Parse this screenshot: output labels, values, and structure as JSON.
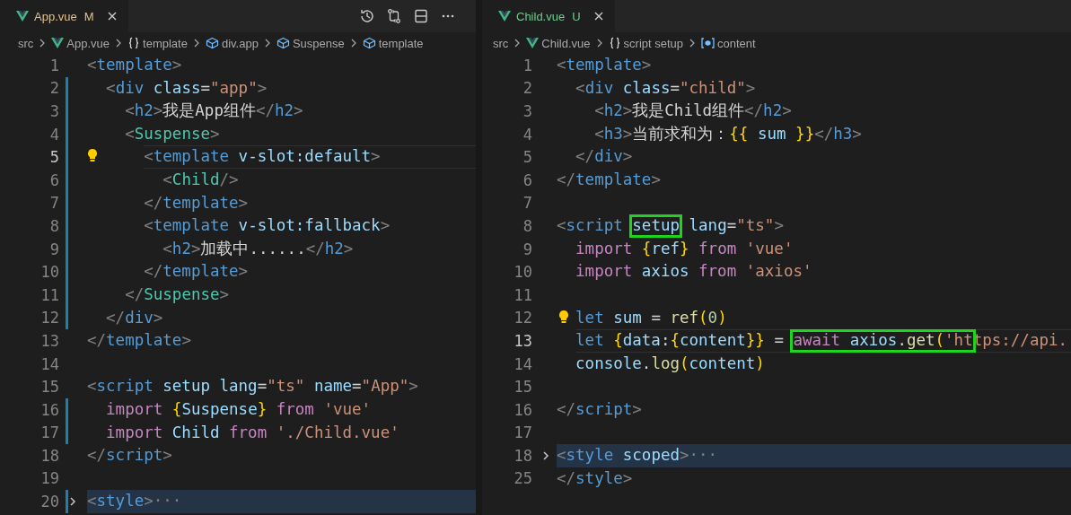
{
  "panes": [
    {
      "tab": {
        "label": "App.vue",
        "status": "M",
        "kind": "modified",
        "selected": true
      },
      "toolbar": true,
      "breadcrumbs": [
        {
          "label": "src",
          "kind": "folder"
        },
        {
          "label": "App.vue",
          "kind": "file"
        },
        {
          "label": "template",
          "kind": "block"
        },
        {
          "label": "div.app",
          "kind": "element"
        },
        {
          "label": "Suspense",
          "kind": "element"
        },
        {
          "label": "template",
          "kind": "element"
        }
      ],
      "lines": [
        {
          "number": "1",
          "tokens": [
            {
              "kind": "punct",
              "text": "<"
            },
            {
              "kind": "tag",
              "text": "template"
            },
            {
              "kind": "punct",
              "text": ">"
            }
          ]
        },
        {
          "number": "2",
          "modified": true,
          "tokens": [
            {
              "kind": "punct",
              "text": "  <"
            },
            {
              "kind": "tag",
              "text": "div"
            },
            {
              "kind": "attr",
              "text": " class"
            },
            {
              "kind": "text",
              "text": "="
            },
            {
              "kind": "string",
              "text": "\"app\""
            },
            {
              "kind": "punct",
              "text": ">"
            }
          ]
        },
        {
          "number": "3",
          "modified": true,
          "tokens": [
            {
              "kind": "punct",
              "text": "    <"
            },
            {
              "kind": "tag",
              "text": "h2"
            },
            {
              "kind": "punct",
              "text": ">"
            },
            {
              "kind": "text",
              "text": "我是App组件"
            },
            {
              "kind": "punct",
              "text": "</"
            },
            {
              "kind": "tag",
              "text": "h2"
            },
            {
              "kind": "punct",
              "text": ">"
            }
          ]
        },
        {
          "number": "4",
          "modified": true,
          "tokens": [
            {
              "kind": "punct",
              "text": "    <"
            },
            {
              "kind": "component",
              "text": "Suspense"
            },
            {
              "kind": "punct",
              "text": ">"
            }
          ]
        },
        {
          "number": "5",
          "modified": true,
          "current": true,
          "hint": true,
          "tokens": [
            {
              "kind": "punct",
              "text": "      <"
            },
            {
              "kind": "tag",
              "text": "template"
            },
            {
              "kind": "attr",
              "text": " v-slot:default"
            },
            {
              "kind": "punct",
              "text": ">"
            }
          ]
        },
        {
          "number": "6",
          "modified": true,
          "tokens": [
            {
              "kind": "punct",
              "text": "        <"
            },
            {
              "kind": "component",
              "text": "Child"
            },
            {
              "kind": "punct",
              "text": "/>"
            }
          ]
        },
        {
          "number": "7",
          "modified": true,
          "tokens": [
            {
              "kind": "punct",
              "text": "      </"
            },
            {
              "kind": "tag",
              "text": "template"
            },
            {
              "kind": "punct",
              "text": ">"
            }
          ]
        },
        {
          "number": "8",
          "modified": true,
          "tokens": [
            {
              "kind": "punct",
              "text": "      <"
            },
            {
              "kind": "tag",
              "text": "template"
            },
            {
              "kind": "attr",
              "text": " v-slot:fallback"
            },
            {
              "kind": "punct",
              "text": ">"
            }
          ]
        },
        {
          "number": "9",
          "modified": true,
          "tokens": [
            {
              "kind": "punct",
              "text": "        <"
            },
            {
              "kind": "tag",
              "text": "h2"
            },
            {
              "kind": "punct",
              "text": ">"
            },
            {
              "kind": "text",
              "text": "加载中......"
            },
            {
              "kind": "punct",
              "text": "</"
            },
            {
              "kind": "tag",
              "text": "h2"
            },
            {
              "kind": "punct",
              "text": ">"
            }
          ]
        },
        {
          "number": "10",
          "modified": true,
          "tokens": [
            {
              "kind": "punct",
              "text": "      </"
            },
            {
              "kind": "tag",
              "text": "template"
            },
            {
              "kind": "punct",
              "text": ">"
            }
          ]
        },
        {
          "number": "11",
          "modified": true,
          "tokens": [
            {
              "kind": "punct",
              "text": "    </"
            },
            {
              "kind": "component",
              "text": "Suspense"
            },
            {
              "kind": "punct",
              "text": ">"
            }
          ]
        },
        {
          "number": "12",
          "modified": true,
          "tokens": [
            {
              "kind": "punct",
              "text": "  </"
            },
            {
              "kind": "tag",
              "text": "div"
            },
            {
              "kind": "punct",
              "text": ">"
            }
          ]
        },
        {
          "number": "13",
          "tokens": [
            {
              "kind": "punct",
              "text": "</"
            },
            {
              "kind": "tag",
              "text": "template"
            },
            {
              "kind": "punct",
              "text": ">"
            }
          ]
        },
        {
          "number": "14"
        },
        {
          "number": "15",
          "tokens": [
            {
              "kind": "punct",
              "text": "<"
            },
            {
              "kind": "tag",
              "text": "script"
            },
            {
              "kind": "attr",
              "text": " setup lang"
            },
            {
              "kind": "text",
              "text": "="
            },
            {
              "kind": "string",
              "text": "\"ts\""
            },
            {
              "kind": "attr",
              "text": " name"
            },
            {
              "kind": "text",
              "text": "="
            },
            {
              "kind": "string",
              "text": "\"App\""
            },
            {
              "kind": "punct",
              "text": ">"
            }
          ]
        },
        {
          "number": "16",
          "modified": true,
          "tokens": [
            {
              "kind": "keyword",
              "text": "  import"
            },
            {
              "kind": "brace",
              "text": " {"
            },
            {
              "kind": "variable",
              "text": "Suspense"
            },
            {
              "kind": "brace",
              "text": "}"
            },
            {
              "kind": "keyword",
              "text": " from"
            },
            {
              "kind": "string",
              "text": " 'vue'"
            }
          ]
        },
        {
          "number": "17",
          "modified": true,
          "tokens": [
            {
              "kind": "keyword",
              "text": "  import"
            },
            {
              "kind": "variable",
              "text": " Child"
            },
            {
              "kind": "keyword",
              "text": " from"
            },
            {
              "kind": "string",
              "text": " './Child.vue'"
            }
          ]
        },
        {
          "number": "18",
          "tokens": [
            {
              "kind": "punct",
              "text": "</"
            },
            {
              "kind": "tag",
              "text": "script"
            },
            {
              "kind": "punct",
              "text": ">"
            }
          ]
        },
        {
          "number": "19"
        },
        {
          "number": "20",
          "modified": true,
          "folded": true,
          "tokens": [
            {
              "kind": "punct",
              "text": "<"
            },
            {
              "kind": "tag",
              "text": "style"
            },
            {
              "kind": "punct",
              "text": ">"
            },
            {
              "kind": "fold",
              "text": "···"
            }
          ]
        }
      ]
    },
    {
      "tab": {
        "label": "Child.vue",
        "status": "U",
        "kind": "untracked",
        "selected": true
      },
      "breadcrumbs": [
        {
          "label": "src",
          "kind": "folder"
        },
        {
          "label": "Child.vue",
          "kind": "file"
        },
        {
          "label": "script setup",
          "kind": "block"
        },
        {
          "label": "content",
          "kind": "variable"
        }
      ],
      "lines": [
        {
          "number": "1",
          "tokens": [
            {
              "kind": "punct",
              "text": "<"
            },
            {
              "kind": "tag",
              "text": "template"
            },
            {
              "kind": "punct",
              "text": ">"
            }
          ]
        },
        {
          "number": "2",
          "tokens": [
            {
              "kind": "punct",
              "text": "  <"
            },
            {
              "kind": "tag",
              "text": "div"
            },
            {
              "kind": "attr",
              "text": " class"
            },
            {
              "kind": "text",
              "text": "="
            },
            {
              "kind": "string",
              "text": "\"child\""
            },
            {
              "kind": "punct",
              "text": ">"
            }
          ]
        },
        {
          "number": "3",
          "tokens": [
            {
              "kind": "punct",
              "text": "    <"
            },
            {
              "kind": "tag",
              "text": "h2"
            },
            {
              "kind": "punct",
              "text": ">"
            },
            {
              "kind": "text",
              "text": "我是Child组件"
            },
            {
              "kind": "punct",
              "text": "</"
            },
            {
              "kind": "tag",
              "text": "h2"
            },
            {
              "kind": "punct",
              "text": ">"
            }
          ]
        },
        {
          "number": "4",
          "tokens": [
            {
              "kind": "punct",
              "text": "    <"
            },
            {
              "kind": "tag",
              "text": "h3"
            },
            {
              "kind": "punct",
              "text": ">"
            },
            {
              "kind": "text",
              "text": "当前求和为："
            },
            {
              "kind": "brace",
              "text": "{{"
            },
            {
              "kind": "variable",
              "text": " sum "
            },
            {
              "kind": "brace",
              "text": "}}"
            },
            {
              "kind": "punct",
              "text": "</"
            },
            {
              "kind": "tag",
              "text": "h3"
            },
            {
              "kind": "punct",
              "text": ">"
            }
          ]
        },
        {
          "number": "5",
          "tokens": [
            {
              "kind": "punct",
              "text": "  </"
            },
            {
              "kind": "tag",
              "text": "div"
            },
            {
              "kind": "punct",
              "text": ">"
            }
          ]
        },
        {
          "number": "6",
          "tokens": [
            {
              "kind": "punct",
              "text": "</"
            },
            {
              "kind": "tag",
              "text": "template"
            },
            {
              "kind": "punct",
              "text": ">"
            }
          ]
        },
        {
          "number": "7"
        },
        {
          "number": "8",
          "tokens": [
            {
              "kind": "punct",
              "text": "<"
            },
            {
              "kind": "tag",
              "text": "script "
            },
            {
              "kind": "attr",
              "text": "setup",
              "boxed": true
            },
            {
              "kind": "attr",
              "text": " lang"
            },
            {
              "kind": "text",
              "text": "="
            },
            {
              "kind": "string",
              "text": "\"ts\""
            },
            {
              "kind": "punct",
              "text": ">"
            }
          ]
        },
        {
          "number": "9",
          "tokens": [
            {
              "kind": "keyword",
              "text": "  import"
            },
            {
              "kind": "brace",
              "text": " {"
            },
            {
              "kind": "variable",
              "text": "ref"
            },
            {
              "kind": "brace",
              "text": "}"
            },
            {
              "kind": "keyword",
              "text": " from"
            },
            {
              "kind": "string",
              "text": " 'vue'"
            }
          ]
        },
        {
          "number": "10",
          "tokens": [
            {
              "kind": "keyword",
              "text": "  import"
            },
            {
              "kind": "variable",
              "text": " axios"
            },
            {
              "kind": "keyword",
              "text": " from"
            },
            {
              "kind": "string",
              "text": " 'axios'"
            }
          ]
        },
        {
          "number": "11"
        },
        {
          "number": "12",
          "hint": true,
          "tokens": [
            {
              "kind": "storage",
              "text": "  let"
            },
            {
              "kind": "variable",
              "text": " sum"
            },
            {
              "kind": "text",
              "text": " = "
            },
            {
              "kind": "function",
              "text": "ref"
            },
            {
              "kind": "brace",
              "text": "("
            },
            {
              "kind": "number",
              "text": "0"
            },
            {
              "kind": "brace",
              "text": ")"
            }
          ]
        },
        {
          "number": "13",
          "current": true,
          "tokens": [
            {
              "kind": "storage",
              "text": "  let"
            },
            {
              "kind": "brace",
              "text": " {"
            },
            {
              "kind": "variable",
              "text": "data"
            },
            {
              "kind": "text",
              "text": ":"
            },
            {
              "kind": "brace",
              "text": "{"
            },
            {
              "kind": "variable",
              "text": "content"
            },
            {
              "kind": "brace",
              "text": "}}"
            },
            {
              "kind": "text",
              "text": " = "
            },
            {
              "kind": "keyword",
              "text": "await",
              "boxed": true
            },
            {
              "kind": "variable",
              "text": " axios",
              "boxed": true
            },
            {
              "kind": "text",
              "text": ".",
              "boxed": true
            },
            {
              "kind": "function",
              "text": "get",
              "boxed": true
            },
            {
              "kind": "brace",
              "text": "(",
              "boxed": true
            },
            {
              "kind": "string",
              "text": "'ht",
              "boxed": true
            },
            {
              "kind": "string",
              "text": "tps://api."
            }
          ]
        },
        {
          "number": "14",
          "tokens": [
            {
              "kind": "variable",
              "text": "  console"
            },
            {
              "kind": "text",
              "text": "."
            },
            {
              "kind": "function",
              "text": "log"
            },
            {
              "kind": "brace",
              "text": "("
            },
            {
              "kind": "variable",
              "text": "content"
            },
            {
              "kind": "brace",
              "text": ")"
            }
          ]
        },
        {
          "number": "15"
        },
        {
          "number": "16",
          "tokens": [
            {
              "kind": "punct",
              "text": "</"
            },
            {
              "kind": "tag",
              "text": "script"
            },
            {
              "kind": "punct",
              "text": ">"
            }
          ]
        },
        {
          "number": "17"
        },
        {
          "number": "18",
          "folded": true,
          "tokens": [
            {
              "kind": "punct",
              "text": "<"
            },
            {
              "kind": "tag",
              "text": "style"
            },
            {
              "kind": "attr",
              "text": " scoped"
            },
            {
              "kind": "punct",
              "text": ">"
            },
            {
              "kind": "fold",
              "text": "···"
            }
          ]
        },
        {
          "number": "25",
          "tokens": [
            {
              "kind": "punct",
              "text": "</"
            },
            {
              "kind": "tag",
              "text": "style"
            },
            {
              "kind": "punct",
              "text": ">"
            }
          ]
        }
      ]
    }
  ]
}
